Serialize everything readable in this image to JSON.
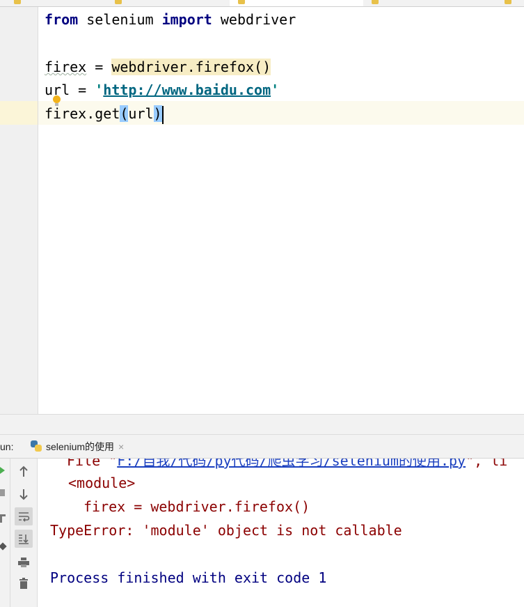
{
  "editor": {
    "lines": {
      "l1": {
        "kw1": "from",
        "t1": " selenium ",
        "kw2": "import",
        "t2": " webdriver"
      },
      "l3": {
        "var": "firex",
        "eq": " = ",
        "call": "webdriver.firefox()"
      },
      "l4": {
        "var": "url",
        "eq": " = ",
        "q1": "'",
        "url": "http://www.baidu.com",
        "q2": "'"
      },
      "l5": {
        "pre": "firex.get",
        "lparen": "(",
        "arg": "url",
        "rparen": ")"
      }
    },
    "intention_icon": "lightbulb-icon"
  },
  "run": {
    "label": "un:",
    "tab_title": "selenium的使用",
    "tab_icon": "python-file-icon",
    "close_glyph": "×"
  },
  "console": {
    "file_prefix": "File \"",
    "file_path": "F:/自我/代码/py代码/爬虫学习/selenium的使用.py",
    "file_suffix": "\", li",
    "module_line": "<module>",
    "code_line": "firex = webdriver.firefox()",
    "error_line": "TypeError: 'module' object is not callable",
    "exit_line": "Process finished with exit code 1"
  },
  "toolbar_icons": [
    "up-arrow-icon",
    "down-arrow-icon",
    "soft-wrap-icon",
    "scroll-to-end-icon",
    "print-icon",
    "trash-icon"
  ],
  "colors": {
    "keyword": "#000080",
    "string": "#008080",
    "error": "#8b0000",
    "link": "#1a3fbf",
    "current_line": "#fcfaed",
    "brace_match": "#99ccff"
  }
}
